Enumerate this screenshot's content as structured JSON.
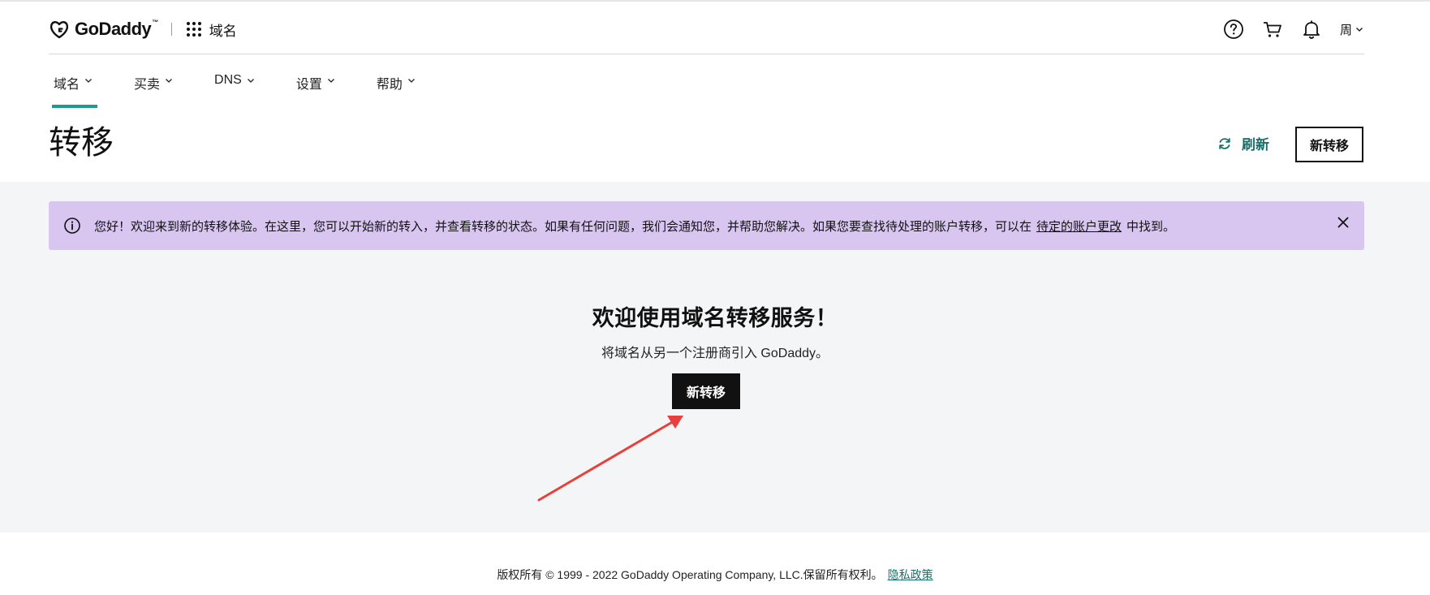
{
  "header": {
    "logo_text": "GoDaddy",
    "logo_tm": "™",
    "product_name": "域名",
    "user_label": "周",
    "icons": [
      "help-icon",
      "cart-icon",
      "bell-icon",
      "chevron-down-icon"
    ]
  },
  "nav": {
    "items": [
      {
        "label": "域名",
        "active": true
      },
      {
        "label": "买卖",
        "active": false
      },
      {
        "label": "DNS",
        "active": false
      },
      {
        "label": "设置",
        "active": false
      },
      {
        "label": "帮助",
        "active": false
      }
    ]
  },
  "page": {
    "title": "转移",
    "refresh_label": "刷新",
    "new_transfer_label": "新转移"
  },
  "banner": {
    "text_before": "您好！欢迎来到新的转移体验。在这里，您可以开始新的转入，并查看转移的状态。如果有任何问题，我们会通知您，并帮助您解决。如果您要查找待处理的账户转移，可以在",
    "link_text": "待定的账户更改",
    "text_after": "中找到。",
    "background": "#d8c6f1"
  },
  "empty_state": {
    "title": "欢迎使用域名转移服务！",
    "subtitle": "将域名从另一个注册商引入 GoDaddy。",
    "button_label": "新转移"
  },
  "footer": {
    "copyright": "版权所有 © 1999 - 2022 GoDaddy Operating Company, LLC.保留所有权利。",
    "privacy_link": "隐私政策"
  },
  "colors": {
    "accent_teal": "#1e9a8f",
    "link_teal": "#1b6f6a",
    "annotation_arrow": "#e8403c"
  }
}
